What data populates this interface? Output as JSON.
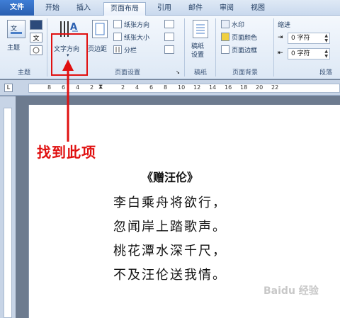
{
  "tabs": [
    {
      "label": "文件"
    },
    {
      "label": "开始"
    },
    {
      "label": "插入"
    },
    {
      "label": "页面布局"
    },
    {
      "label": "引用"
    },
    {
      "label": "邮件"
    },
    {
      "label": "审阅"
    },
    {
      "label": "视图"
    }
  ],
  "ribbon": {
    "theme_label": "主题",
    "text_direction_label": "文字方向",
    "margins_label": "页边距",
    "orientation_label": "纸张方向",
    "size_label": "纸张大小",
    "columns_label": "分栏",
    "manuscript_label": "稿纸\n设置",
    "watermark_label": "水印",
    "page_color_label": "页面颜色",
    "page_border_label": "页面边框",
    "indent_label": "缩进",
    "indent_left": "0 字符",
    "indent_right": "0 字符",
    "groups": {
      "theme": "主题",
      "page_setup": "页面设置",
      "manuscript": "稿纸",
      "page_background": "页面背景",
      "paragraph": "段落"
    }
  },
  "ruler": {
    "box": "L",
    "numbers": [
      "8",
      "6",
      "4",
      "2",
      "2",
      "4",
      "6",
      "8",
      "10",
      "12",
      "14",
      "16",
      "18",
      "20",
      "22"
    ]
  },
  "annotation": "找到此项",
  "poem": {
    "title": "《赠汪伦》",
    "lines": [
      "李白乘舟将欲行，",
      "忽闻岸上踏歌声。",
      "桃花潭水深千尺，",
      "不及汪伦送我情。"
    ]
  },
  "watermark": "Baidu 经验",
  "colors": {
    "accent_red": "#e01010",
    "file_tab": "#2a5fb0"
  }
}
